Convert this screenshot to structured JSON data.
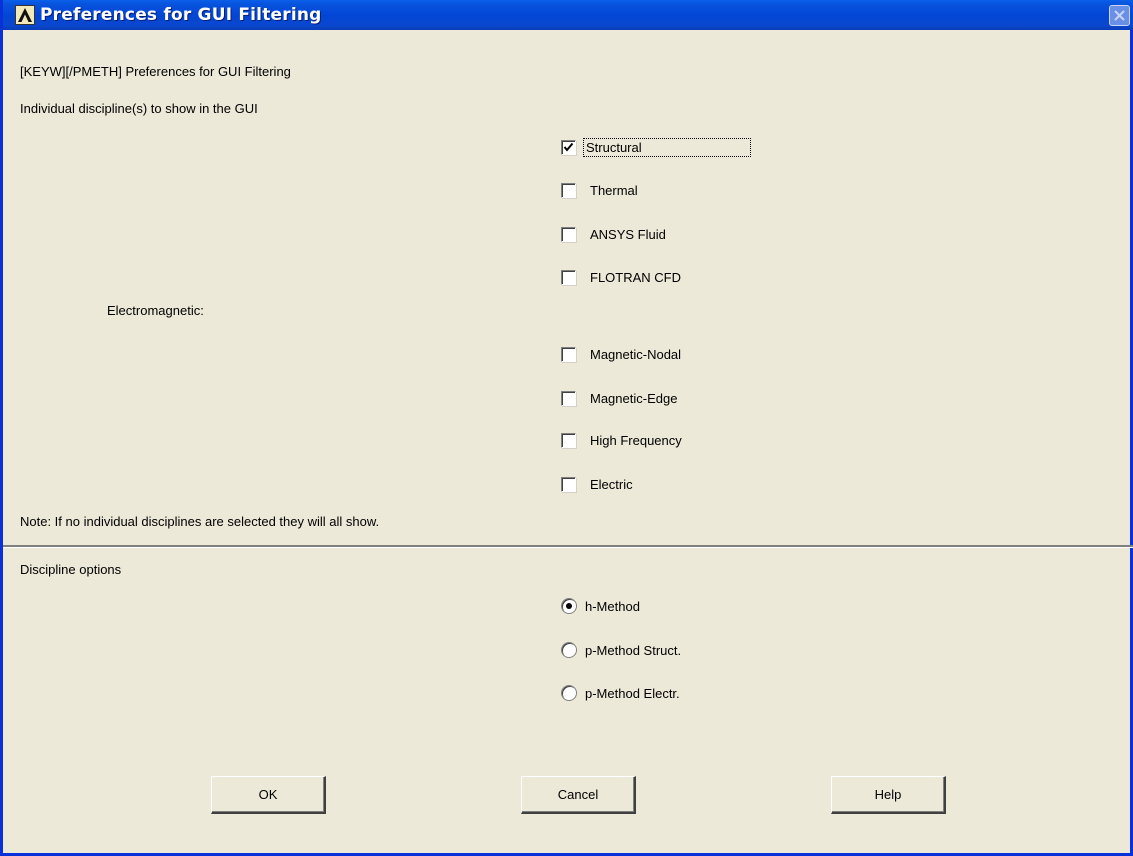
{
  "window": {
    "title": "Preferences for GUI Filtering",
    "close_icon": "close-icon",
    "app_icon": "ansys-logo-icon"
  },
  "header": {
    "command": "[KEYW][/PMETH] Preferences for GUI Filtering",
    "disciplines_label": "Individual discipline(s) to show in the GUI"
  },
  "disciplines": [
    {
      "label": "Structural",
      "checked": true
    },
    {
      "label": "Thermal",
      "checked": false
    },
    {
      "label": "ANSYS Fluid",
      "checked": false
    },
    {
      "label": "FLOTRAN CFD",
      "checked": false
    }
  ],
  "electromagnetic": {
    "label": "Electromagnetic:",
    "items": [
      {
        "label": "Magnetic-Nodal",
        "checked": false
      },
      {
        "label": "Magnetic-Edge",
        "checked": false
      },
      {
        "label": "High Frequency",
        "checked": false
      },
      {
        "label": "Electric",
        "checked": false
      }
    ]
  },
  "note": "Note: If no individual disciplines are selected they will all show.",
  "options": {
    "label": "Discipline options",
    "radios": [
      {
        "label": "h-Method",
        "selected": true
      },
      {
        "label": "p-Method Struct.",
        "selected": false
      },
      {
        "label": "p-Method Electr.",
        "selected": false
      }
    ]
  },
  "buttons": {
    "ok": "OK",
    "cancel": "Cancel",
    "help": "Help"
  },
  "colors": {
    "titlebar": "#0246D5",
    "dialog_bg": "#ECE9D8",
    "title_text": "#FFFFFF"
  }
}
